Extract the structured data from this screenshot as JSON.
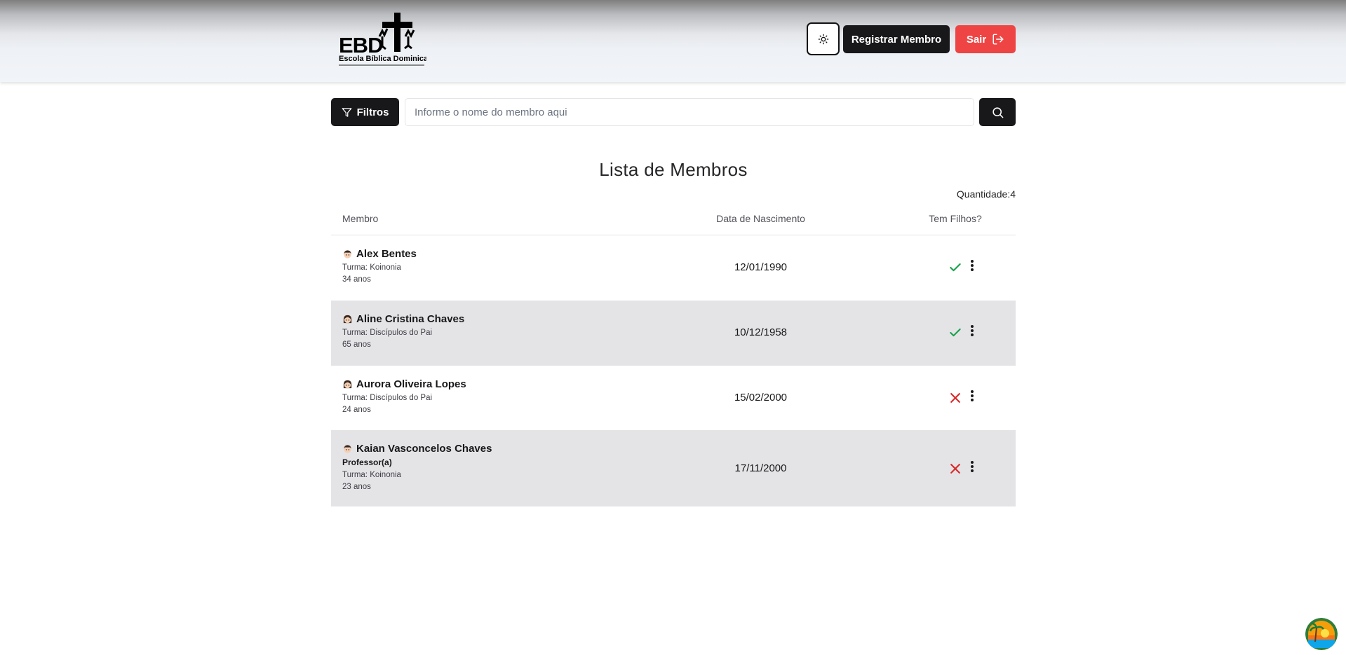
{
  "header": {
    "logo": {
      "alt_text": "EBD Escola Bíblica Dominical",
      "icon": "ebd-cross-logo"
    },
    "theme_icon": "sun-icon",
    "register_label": "Registrar Membro",
    "exit_label": "Sair",
    "exit_icon": "logout-icon"
  },
  "search": {
    "filters_label": "Filtros",
    "filter_icon": "funnel-icon",
    "placeholder": "Informe o nome do membro aqui",
    "value": "",
    "search_icon": "search-icon"
  },
  "page": {
    "title": "Lista de Membros",
    "quantity_text": "Quantidade:4"
  },
  "table": {
    "columns": [
      "Membro",
      "Data de Nascimento",
      "Tem Filhos?"
    ],
    "rows": [
      {
        "name": "Alex Bentes",
        "avatar": "male-avatar",
        "role": "",
        "turma": "Turma: Koinonia",
        "age": "34 anos",
        "birth": "12/01/1990",
        "has_children": true
      },
      {
        "name": "Aline Cristina Chaves",
        "avatar": "female-avatar",
        "role": "",
        "turma": "Turma: Discípulos do Pai",
        "age": "65 anos",
        "birth": "10/12/1958",
        "has_children": true
      },
      {
        "name": "Aurora Oliveira Lopes",
        "avatar": "female-avatar",
        "role": "",
        "turma": "Turma: Discípulos do Pai",
        "age": "24 anos",
        "birth": "15/02/2000",
        "has_children": false
      },
      {
        "name": "Kaian Vasconcelos Chaves",
        "avatar": "male-avatar",
        "role": "Professor(a)",
        "turma": "Turma: Koinonia",
        "age": "23 anos",
        "birth": "17/11/2000",
        "has_children": false
      }
    ]
  },
  "colors": {
    "primary_dark": "#18181b",
    "danger": "#ef4444",
    "check_green": "#16a34a",
    "cross_red": "#dc2626",
    "row_shade": "#e4e4e7"
  },
  "floating_widget_icon": "beach-sunset-icon"
}
